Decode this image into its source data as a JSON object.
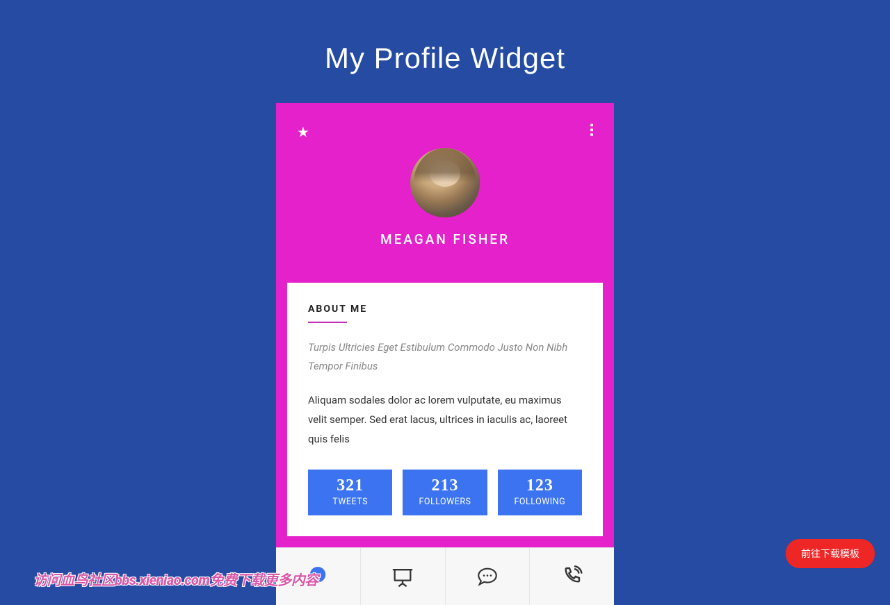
{
  "page_title": "My Profile Widget",
  "profile": {
    "username": "MEAGAN FISHER"
  },
  "about": {
    "heading": "ABOUT ME",
    "subtitle": "Turpis Ultricies Eget Estibulum Commodo Justo Non Nibh Tempor Finibus",
    "description": "Aliquam sodales dolor ac lorem vulputate, eu maximus velit semper. Sed erat lacus, ultrices in iaculis ac, laoreet quis felis"
  },
  "stats": [
    {
      "value": "321",
      "label": "TWEETS"
    },
    {
      "value": "213",
      "label": "FOLLOWERS"
    },
    {
      "value": "123",
      "label": "FOLLOWING"
    }
  ],
  "tabs": [
    {
      "name": "support",
      "active": true
    },
    {
      "name": "presentation",
      "active": false
    },
    {
      "name": "chat",
      "active": false
    },
    {
      "name": "call",
      "active": false
    }
  ],
  "download_button": "前往下载模板",
  "watermark": "访问血鸟社区bbs.xieniao.com免费下载更多内容",
  "colors": {
    "page_bg": "#254ba3",
    "header_bg": "#e421cb",
    "stat_bg": "#3b73f0",
    "accent": "#c030b8",
    "download_btn": "#ef2626"
  }
}
